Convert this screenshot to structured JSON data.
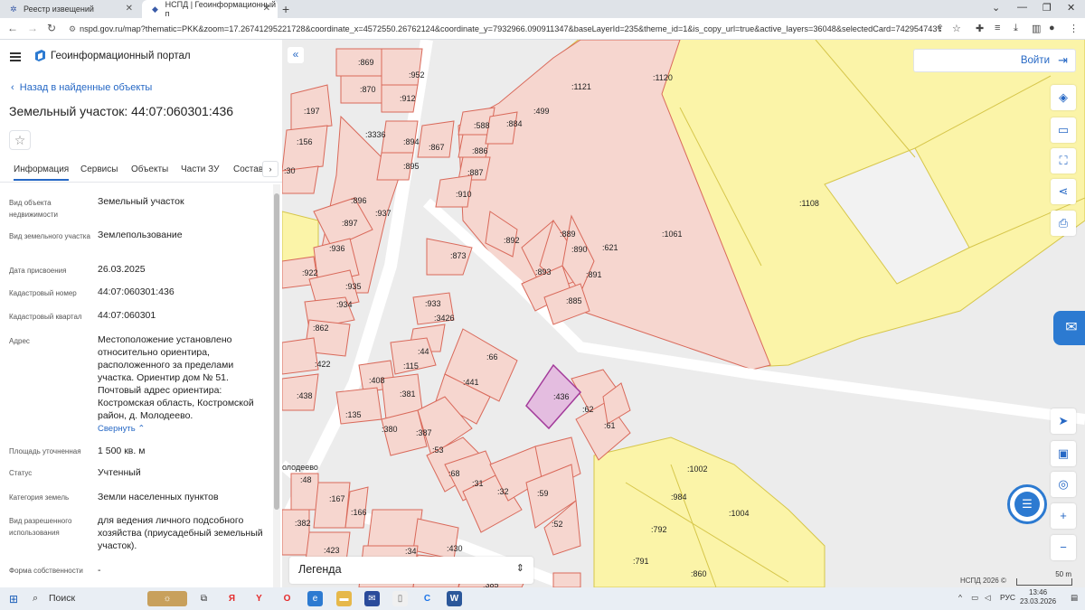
{
  "browser": {
    "tabs": [
      {
        "title": "Реестр извещений"
      },
      {
        "title": "НСПД | Геоинформационный п"
      }
    ],
    "url": "nspd.gov.ru/map?thematic=PKK&zoom=17.26741295221728&coordinate_x=4572550.26762124&coordinate_y=7932966.090911347&baseLayerId=235&theme_id=1&is_copy_url=true&active_layers=36048&selectedCard=742954743%2C363..."
  },
  "header": {
    "title": "Геоинформационный портал"
  },
  "panel": {
    "back_label": "Назад в найденные объекты",
    "object_title": "Земельный участок: 44:07:060301:436",
    "tabs": [
      "Информация",
      "Сервисы",
      "Объекты",
      "Части ЗУ",
      "Состав"
    ],
    "collapse_label": "Свернуть",
    "rows": [
      {
        "label": "Вид объекта недвижимости",
        "value": "Земельный участок"
      },
      {
        "label": "Вид земельного участка",
        "value": "Землепользование"
      },
      {
        "label": "Дата присвоения",
        "value": "26.03.2025"
      },
      {
        "label": "Кадастровый номер",
        "value": "44:07:060301:436"
      },
      {
        "label": "Кадастровый квартал",
        "value": "44:07:060301"
      },
      {
        "label": "Адрес",
        "value": "Местоположение установлено относительно ориентира, расположенного за пределами участка. Ориентир дом № 51. Почтовый адрес ориентира: Костромская область, Костромской район, д. Молодеево."
      },
      {
        "label": "Площадь уточненная",
        "value": "1 500 кв. м"
      },
      {
        "label": "Статус",
        "value": "Учтенный"
      },
      {
        "label": "Категория земель",
        "value": "Земли населенных пунктов"
      },
      {
        "label": "Вид разрешенного использования",
        "value": "для ведения личного подсобного хозяйства (приусадебный земельный участок)."
      },
      {
        "label": "Форма собственности",
        "value": "-"
      }
    ]
  },
  "map": {
    "login_label": "Войти",
    "legend_label": "Легенда",
    "attribution": "НСПД 2026 ©",
    "scale_label": "50 m",
    "street_label": "олодеево",
    "selected_parcel": ":436",
    "parcel_labels": [
      ":869",
      ":952",
      ":870",
      ":912",
      ":197",
      ":588",
      ":884",
      ":499",
      ":1121",
      ":1120",
      ":3336",
      ":894",
      ":867",
      ":156",
      ":886",
      ":895",
      ":887",
      ":30",
      ":910",
      ":1108",
      ":896",
      ":937",
      ":897",
      ":892",
      ":889",
      ":890",
      ":621",
      ":1061",
      ":936",
      ":873",
      ":893",
      ":891",
      ":922",
      ":935",
      ":934",
      ":885",
      ":933",
      ":3426",
      ":862",
      ":44",
      ":66",
      ":422",
      ":115",
      ":408",
      ":441",
      ":438",
      ":381",
      ":436",
      ":62",
      ":135",
      ":380",
      ":387",
      ":61",
      ":53",
      ":1002",
      ":48",
      ":68",
      ":31",
      ":32",
      ":59",
      ":984",
      ":167",
      ":166",
      ":1004",
      ":382",
      ":52",
      ":792",
      ":423",
      ":34",
      ":430",
      ":791",
      ":860",
      ":385"
    ],
    "colors": {
      "parcel_fill": "#f6d6cf",
      "parcel_stroke": "#d9695a",
      "yellow_fill": "#fbf4a8",
      "yellow_stroke": "#d6c64a",
      "selected_fill": "#e4bde0",
      "selected_stroke": "#a23a9a"
    }
  },
  "taskbar": {
    "search_label": "Поиск",
    "lang": "РУС",
    "time": "13:46",
    "date": "23.03.2026"
  }
}
